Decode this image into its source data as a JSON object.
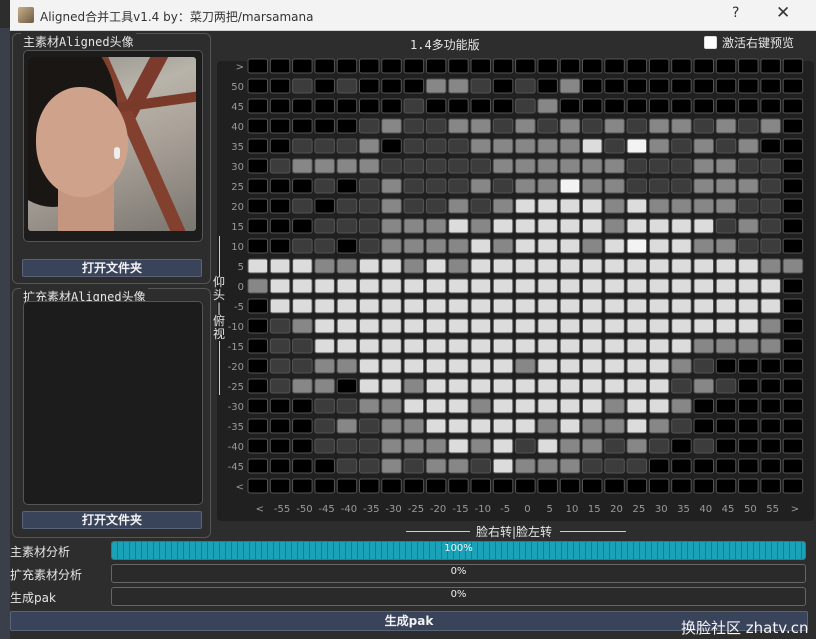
{
  "window": {
    "title": "Aligned合并工具v1.4  by：菜刀两把/marsamana",
    "help_glyph": "?",
    "close_glyph": "✕"
  },
  "main_source": {
    "title": "主素材Aligned头像",
    "open_button": "打开文件夹"
  },
  "extra_source": {
    "title": "扩充素材Aligned头像",
    "open_button": "打开文件夹"
  },
  "grid": {
    "title": "1.4多功能版",
    "preview_checkbox": {
      "label": "激活右键预览",
      "checked": false
    },
    "vertical_label": "仰头—俯视",
    "horizontal_label": "脸右转|脸左转",
    "y_ticks": [
      ">",
      "50",
      "45",
      "40",
      "35",
      "30",
      "25",
      "20",
      "15",
      "10",
      "5",
      "0",
      "-5",
      "-10",
      "-15",
      "-20",
      "-25",
      "-30",
      "-35",
      "-40",
      "-45",
      "<"
    ],
    "x_ticks": [
      "<",
      "-55",
      "-50",
      "-45",
      "-40",
      "-35",
      "-30",
      "-25",
      "-20",
      "-15",
      "-10",
      "-5",
      "0",
      "5",
      "10",
      "15",
      "20",
      "25",
      "30",
      "35",
      "40",
      "45",
      "50",
      "55",
      ">"
    ],
    "shade_levels": [
      "empty",
      "dark",
      "medium",
      "light",
      "bright"
    ],
    "shade_colors": [
      "#000000",
      "#3c3c3c",
      "#878787",
      "#dcdcdc",
      "#f3f3f3"
    ],
    "rows": [
      "0000000000000000000000000",
      "0010100022101020000000000",
      "0000000100001200000000000",
      "0000012112212121212212120",
      "0011120111222223142121200",
      "0122221111122222211122110",
      "0001012111212242211122210",
      "0010112112123333232222110",
      "0001112223233333233331210",
      "0011012222323332343322110",
      "3332233232333333333333322",
      "2333333333333333333333330",
      "0333333333333333333333330",
      "0123333333333333333333320",
      "0113333333333333333322220",
      "0112233333332333333210000",
      "0122033233333333333121000",
      "0001122333233333233200000",
      "0001212233333232232100000",
      "0001112223231322121010000",
      "0000112122132221110000000",
      "0000000000000000000000000"
    ]
  },
  "analysis": {
    "main_label": "主素材分析",
    "main_percent": 100,
    "main_text": "100%",
    "extra_label": "扩充素材分析",
    "extra_percent": 0,
    "extra_text": "0%",
    "pak_label": "生成pak",
    "pak_percent": 0,
    "pak_text": "0%",
    "generate_button": "生成pak"
  },
  "watermark": "换脸社区 zhatv.cn"
}
